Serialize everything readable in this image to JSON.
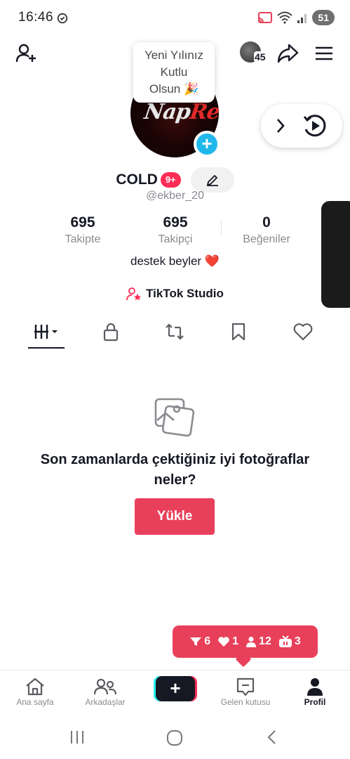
{
  "status_bar": {
    "time": "16:46",
    "battery": "51"
  },
  "tooltip": {
    "text_lines": [
      "Yeni Yılınız",
      "Kutlu",
      "Olsun 🎉"
    ]
  },
  "header": {
    "visitor_count": "45"
  },
  "avatar": {
    "logo_text_a": "Nap",
    "logo_text_b": "Red"
  },
  "profile": {
    "display_name": "COLD",
    "notification_count": "9+",
    "handle": "@ekber_20",
    "bio": "destek beyler ❤️",
    "studio_label": "TikTok Studio"
  },
  "stats": [
    {
      "value": "695",
      "label": "Takipte"
    },
    {
      "value": "695",
      "label": "Takipçi"
    },
    {
      "value": "0",
      "label": "Beğeniler"
    }
  ],
  "tabs": [
    {
      "name": "videos",
      "icon": "grid-icon",
      "active": true
    },
    {
      "name": "private",
      "icon": "lock-icon"
    },
    {
      "name": "reposts",
      "icon": "repost-icon"
    },
    {
      "name": "favorites",
      "icon": "bookmark-icon"
    },
    {
      "name": "liked",
      "icon": "heart-icon"
    }
  ],
  "empty_state": {
    "title": "Son zamanlarda çektiğiniz iyi fotoğraflar neler?",
    "button_label": "Yükle"
  },
  "activity": {
    "followers_new": "6",
    "likes": "1",
    "followers": "12",
    "live": "3"
  },
  "bottom_nav": [
    {
      "label": "Ana sayfa",
      "icon": "home-icon"
    },
    {
      "label": "Arkadaşlar",
      "icon": "friends-icon"
    },
    {
      "label": "",
      "icon": "plus-icon"
    },
    {
      "label": "Gelen kutusu",
      "icon": "inbox-icon"
    },
    {
      "label": "Profil",
      "icon": "profile-icon",
      "active": true
    }
  ],
  "colors": {
    "accent": "#fe2c55",
    "button": "#e8405a",
    "badge_blue": "#20b8ea"
  }
}
